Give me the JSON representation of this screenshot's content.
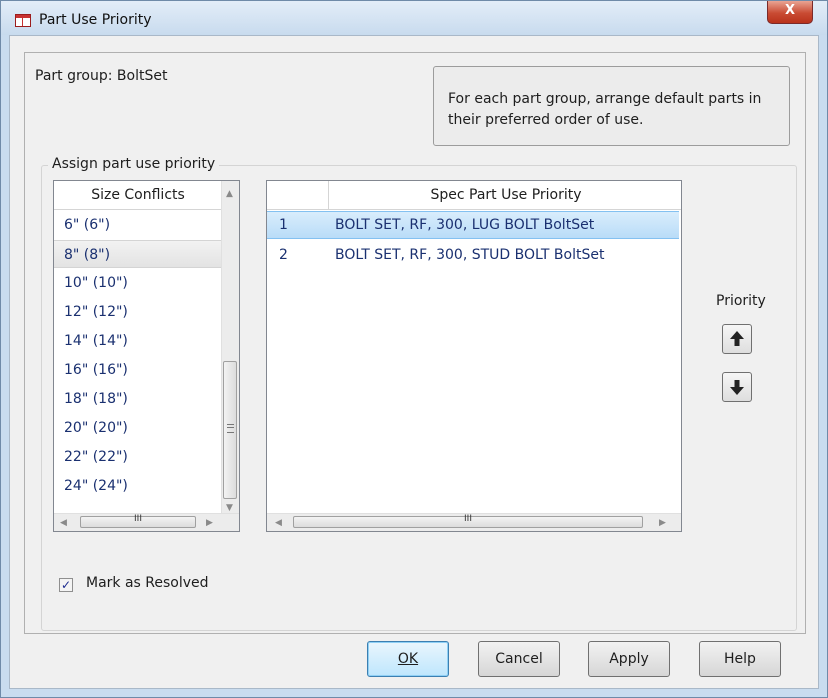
{
  "window": {
    "title": "Part Use Priority",
    "close_glyph": "X",
    "icon": "dialog-icon"
  },
  "part_group": "Part group: BoltSet",
  "info_text": [
    "For each part group, arrange default parts in",
    "their preferred order of use."
  ],
  "group_label": "Assign part use priority",
  "size_list": {
    "header": "Size Conflicts",
    "selected_index": 1,
    "items": [
      "6\" (6\")",
      "8\" (8\")",
      "10\" (10\")",
      "12\" (12\")",
      "14\" (14\")",
      "16\" (16\")",
      "18\" (18\")",
      "20\" (20\")",
      "22\" (22\")",
      "24\" (24\")"
    ]
  },
  "spec_list": {
    "header": "Spec Part Use Priority",
    "selected_index": 0,
    "rows": [
      {
        "num": "1",
        "text": "BOLT SET, RF, 300, LUG BOLT BoltSet"
      },
      {
        "num": "2",
        "text": "BOLT SET, RF, 300, STUD BOLT BoltSet"
      }
    ]
  },
  "priority_label": "Priority",
  "mark_resolved": {
    "label": "Mark as Resolved",
    "checked": true
  },
  "buttons": {
    "ok": "OK",
    "cancel": "Cancel",
    "apply": "Apply",
    "help": "Help"
  },
  "colors": {
    "selection": "#b9dcf8",
    "list_text": "#1a3070",
    "title_bar": "#c8dbee"
  }
}
